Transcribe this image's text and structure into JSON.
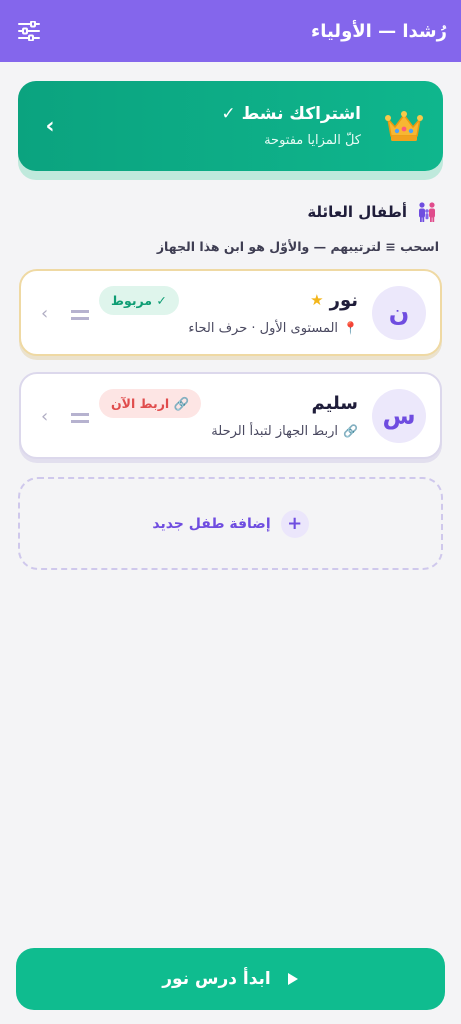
{
  "header": {
    "title": "رُشدا — الأولياء",
    "settings_icon": "sliders-icon"
  },
  "subscription": {
    "title": "اشتراكك نشط ✓",
    "subtitle": "كلّ المزايا مفتوحة",
    "icon": "crown-icon",
    "chevron": "›",
    "colors": {
      "start": "#0ba37f",
      "end": "#0fb68d"
    }
  },
  "family": {
    "title": "أطفال العائلة",
    "icon": "family-icon",
    "hint": "اسحب ≡ لترتيبهم — والأوّل هو ابن هذا الجهاز"
  },
  "children": [
    {
      "initial": "ن",
      "name": "نور",
      "star": "★",
      "detail_icon": "📍",
      "detail": "المستوى الأول · حرف الحاء",
      "badge": "✓ مربوط",
      "chevron": "›"
    },
    {
      "initial": "س",
      "name": "سليم",
      "detail_icon": "🔗",
      "detail": "اربط الجهاز لتبدأ الرحلة",
      "badge": "🔗 اربط الآن",
      "chevron": "›"
    }
  ],
  "add_child": {
    "plus": "+",
    "label": "إضافة طفل جديد"
  },
  "cta": {
    "label": "ابدأ درس نور",
    "color": "#0fbc8f"
  },
  "colors": {
    "header": "#8466ec",
    "accent": "#6f4de0",
    "linked": "#0f9d74",
    "unlinked": "#e04c4c"
  }
}
